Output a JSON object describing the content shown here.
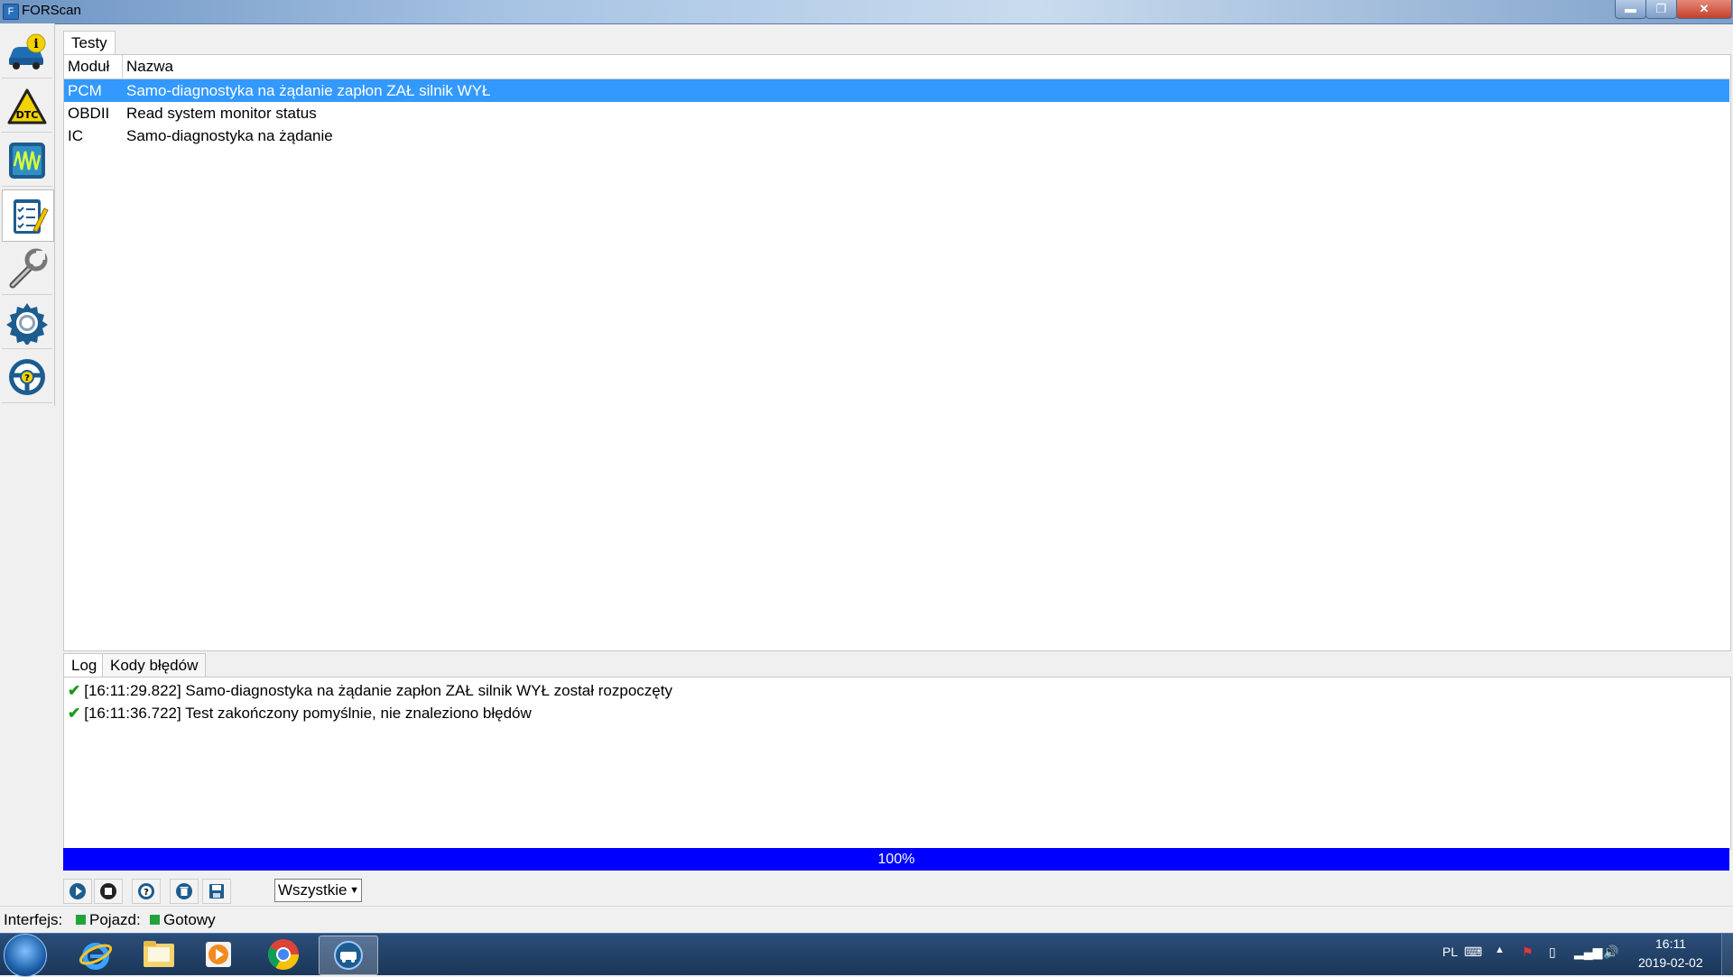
{
  "window": {
    "title": "FORScan",
    "min_label": "▬",
    "max_label": "❐",
    "close_label": "✕"
  },
  "sidebar": {
    "items": [
      {
        "name": "vehicle-info"
      },
      {
        "name": "dtc"
      },
      {
        "name": "oscilloscope"
      },
      {
        "name": "tests"
      },
      {
        "name": "service"
      },
      {
        "name": "settings"
      },
      {
        "name": "help"
      }
    ],
    "active_index": 3
  },
  "tests": {
    "tab_label": "Testy",
    "columns": [
      "Moduł",
      "Nazwa"
    ],
    "rows": [
      {
        "module": "PCM",
        "name": "Samo-diagnostyka na żądanie zapłon ZAŁ silnik WYŁ",
        "selected": true
      },
      {
        "module": "OBDII",
        "name": "Read system monitor status",
        "selected": false
      },
      {
        "module": "IC",
        "name": "Samo-diagnostyka na żądanie",
        "selected": false
      }
    ]
  },
  "log": {
    "tabs": [
      "Log",
      "Kody błędów"
    ],
    "lines": [
      "[16:11:29.822] Samo-diagnostyka na żądanie zapłon ZAŁ silnik WYŁ został rozpoczęty",
      "[16:11:36.722] Test zakończony pomyślnie, nie znaleziono błędów"
    ]
  },
  "progress": {
    "value": 100,
    "label": "100%"
  },
  "toolbar": {
    "filter_value": "Wszystkie"
  },
  "status": {
    "interface_label": "Interfejs:",
    "vehicle_label": "Pojazd:",
    "ready_label": "Gotowy",
    "indicator_color": "#22a33a"
  },
  "taskbar": {
    "lang": "PL",
    "time": "16:11",
    "date": "2019-02-02"
  },
  "colors": {
    "selection": "#3399ff",
    "progress": "#0000ff"
  }
}
